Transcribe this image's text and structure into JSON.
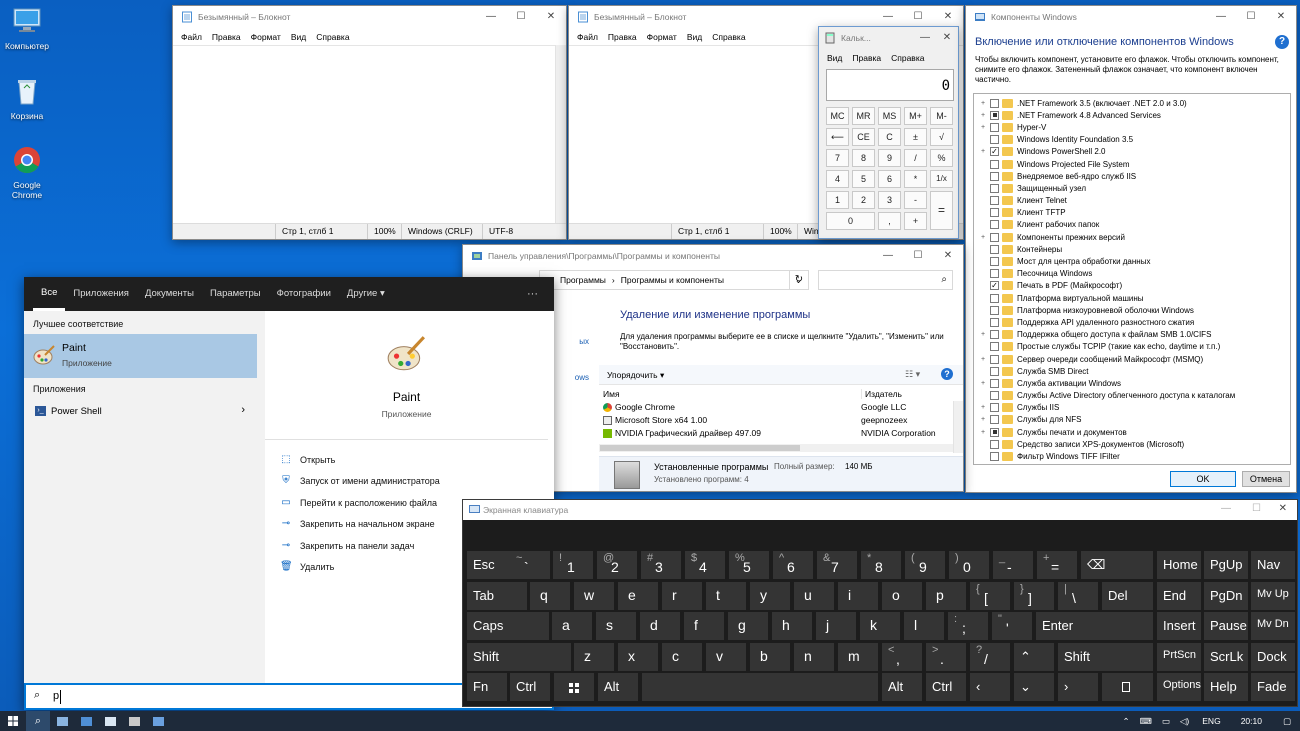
{
  "colors": {
    "accent": "#0078d7",
    "desktop": "#0b6fd8",
    "keyboard_bg": "#1c1c1c",
    "key": "#343434",
    "start_dark": "#1f1f1f"
  },
  "desktop": {
    "icons": [
      {
        "label": "Компьютер",
        "icon": "computer-icon"
      },
      {
        "label": "Корзина",
        "icon": "recycle-bin-icon"
      },
      {
        "label": "Google Chrome",
        "icon": "chrome-icon"
      }
    ]
  },
  "notepad1": {
    "title": "Безымянный – Блокнот",
    "menu": [
      "Файл",
      "Правка",
      "Формат",
      "Вид",
      "Справка"
    ],
    "status": {
      "position": "Стр 1, стлб 1",
      "zoom": "100%",
      "eol": "Windows (CRLF)",
      "encoding": "UTF-8"
    }
  },
  "notepad2": {
    "title": "Безымянный – Блокнот",
    "menu": [
      "Файл",
      "Правка",
      "Формат",
      "Вид",
      "Справка"
    ],
    "status": {
      "position": "Стр 1, стлб 1",
      "zoom": "100%",
      "eol": "Win"
    }
  },
  "calculator": {
    "title": "Кальк...",
    "menu": [
      "Вид",
      "Правка",
      "Справка"
    ],
    "display": "0",
    "buttons": {
      "mc": "MC",
      "mr": "MR",
      "ms": "MS",
      "mplus": "M+",
      "mminus": "M-",
      "back": "⟵",
      "ce": "CE",
      "c": "C",
      "pm": "±",
      "sqrt": "√",
      "n7": "7",
      "n8": "8",
      "n9": "9",
      "div": "/",
      "pct": "%",
      "n4": "4",
      "n5": "5",
      "n6": "6",
      "mul": "*",
      "inv": "1/x",
      "n1": "1",
      "n2": "2",
      "n3": "3",
      "sub": "-",
      "eq": "=",
      "n0": "0",
      "dot": ",",
      "add": "+"
    }
  },
  "components": {
    "title": "Компоненты Windows",
    "heading": "Включение или отключение компонентов Windows",
    "description": "Чтобы включить компонент, установите его флажок. Чтобы отключить компонент, снимите его флажок. Затененный флажок означает, что компонент включен частично.",
    "items": [
      {
        "label": ".NET Framework 3.5 (включает .NET 2.0 и 3.0)",
        "expand": "+",
        "state": ""
      },
      {
        "label": ".NET Framework 4.8 Advanced Services",
        "expand": "+",
        "state": "part"
      },
      {
        "label": "Hyper-V",
        "expand": "+",
        "state": ""
      },
      {
        "label": "Windows Identity Foundation 3.5",
        "expand": "",
        "state": ""
      },
      {
        "label": "Windows PowerShell 2.0",
        "expand": "+",
        "state": "check"
      },
      {
        "label": "Windows Projected File System",
        "expand": "",
        "state": ""
      },
      {
        "label": "Внедряемое веб-ядро служб IIS",
        "expand": "",
        "state": ""
      },
      {
        "label": "Защищенный узел",
        "expand": "",
        "state": ""
      },
      {
        "label": "Клиент Telnet",
        "expand": "",
        "state": ""
      },
      {
        "label": "Клиент TFTP",
        "expand": "",
        "state": ""
      },
      {
        "label": "Клиент рабочих папок",
        "expand": "",
        "state": ""
      },
      {
        "label": "Компоненты прежних версий",
        "expand": "+",
        "state": ""
      },
      {
        "label": "Контейнеры",
        "expand": "",
        "state": ""
      },
      {
        "label": "Мост для центра обработки данных",
        "expand": "",
        "state": ""
      },
      {
        "label": "Песочница Windows",
        "expand": "",
        "state": ""
      },
      {
        "label": "Печать в PDF (Майкрософт)",
        "expand": "",
        "state": "check"
      },
      {
        "label": "Платформа виртуальной машины",
        "expand": "",
        "state": ""
      },
      {
        "label": "Платформа низкоуровневой оболочки Windows",
        "expand": "",
        "state": ""
      },
      {
        "label": "Поддержка API удаленного разностного сжатия",
        "expand": "",
        "state": ""
      },
      {
        "label": "Поддержка общего доступа к файлам SMB 1.0/CIFS",
        "expand": "+",
        "state": ""
      },
      {
        "label": "Простые службы TCPIP (такие как echo, daytime и т.п.)",
        "expand": "",
        "state": ""
      },
      {
        "label": "Сервер очереди сообщений Майкрософт (MSMQ)",
        "expand": "+",
        "state": ""
      },
      {
        "label": "Служба SMB Direct",
        "expand": "",
        "state": ""
      },
      {
        "label": "Служба активации Windows",
        "expand": "+",
        "state": ""
      },
      {
        "label": "Службы Active Directory облегченного доступа к каталогам",
        "expand": "",
        "state": ""
      },
      {
        "label": "Службы IIS",
        "expand": "+",
        "state": ""
      },
      {
        "label": "Службы для NFS",
        "expand": "+",
        "state": ""
      },
      {
        "label": "Службы печати и документов",
        "expand": "+",
        "state": "part"
      },
      {
        "label": "Средство записи XPS-документов (Microsoft)",
        "expand": "",
        "state": ""
      },
      {
        "label": "Фильтр Windows TIFF IFilter",
        "expand": "",
        "state": ""
      }
    ],
    "ok": "OK",
    "cancel": "Отмена"
  },
  "control_panel": {
    "title": "Панель управления\\Программы\\Программы и компоненты",
    "breadcrumb": [
      "Программы",
      "Программы и компоненты"
    ],
    "heading": "Удаление или изменение программы",
    "description": "Для удаления программы выберите ее в списке и щелкните \"Удалить\", \"Изменить\" или \"Восстановить\".",
    "organize": "Упорядочить",
    "col_name": "Имя",
    "col_publisher": "Издатель",
    "programs": [
      {
        "name": "Google Chrome",
        "publisher": "Google LLC"
      },
      {
        "name": "Microsoft Store x64 1.00",
        "publisher": "geepnozeex"
      },
      {
        "name": "NVIDIA Графический драйвер 497.09",
        "publisher": "NVIDIA Corporation"
      }
    ],
    "left_links": [
      "ых",
      "ows"
    ],
    "summary_title": "Установленные программы",
    "summary_size_label": "Полный размер:",
    "summary_size": "140 МБ",
    "summary_count": "Установлено программ: 4"
  },
  "start_menu": {
    "tabs": [
      "Все",
      "Приложения",
      "Документы",
      "Параметры",
      "Фотографии",
      "Другие"
    ],
    "more": "···",
    "best_match_header": "Лучшее соответствие",
    "best_match": {
      "name": "Paint",
      "type": "Приложение"
    },
    "apps_header": "Приложения",
    "apps": [
      {
        "name": "Power Shell"
      }
    ],
    "preview": {
      "name": "Paint",
      "type": "Приложение"
    },
    "actions": [
      {
        "label": "Открыть",
        "icon": "open-icon"
      },
      {
        "label": "Запуск от имени администратора",
        "icon": "admin-icon"
      },
      {
        "label": "Перейти к расположению файла",
        "icon": "folder-icon"
      },
      {
        "label": "Закрепить на начальном экране",
        "icon": "pin-icon"
      },
      {
        "label": "Закрепить на панели задач",
        "icon": "pin-taskbar-icon"
      },
      {
        "label": "Удалить",
        "icon": "trash-icon"
      }
    ],
    "search_value": "p"
  },
  "osk": {
    "title": "Экранная клавиатура",
    "keys": {
      "esc": "Esc",
      "tilde_sup": "~",
      "tilde": "`",
      "n1_sup": "!",
      "n1": "1",
      "n2_sup": "@",
      "n2": "2",
      "n3_sup": "#",
      "n3": "3",
      "n4_sup": "$",
      "n4": "4",
      "n5_sup": "%",
      "n5": "5",
      "n6_sup": "^",
      "n6": "6",
      "n7_sup": "&",
      "n7": "7",
      "n8_sup": "*",
      "n8": "8",
      "n9_sup": "(",
      "n9": "9",
      "n0_sup": ")",
      "n0": "0",
      "minus_sup": "_",
      "minus": "-",
      "eq_sup": "+",
      "eq": "=",
      "bksp": "⌫",
      "tab": "Tab",
      "q": "q",
      "w": "w",
      "e": "e",
      "r": "r",
      "t": "t",
      "y": "y",
      "u": "u",
      "i": "i",
      "o": "o",
      "p": "p",
      "lb_sup": "{",
      "lb": "[",
      "rb_sup": "}",
      "rb": "]",
      "bs_sup": "|",
      "bs": "\\",
      "del": "Del",
      "caps": "Caps",
      "a": "a",
      "s": "s",
      "d": "d",
      "f": "f",
      "g": "g",
      "h": "h",
      "j": "j",
      "k": "k",
      "l": "l",
      "semi_sup": ":",
      "semi": ";",
      "quote_sup": "\"",
      "quote": "'",
      "enter": "Enter",
      "shift": "Shift",
      "z": "z",
      "x": "x",
      "c": "c",
      "v": "v",
      "b": "b",
      "n": "n",
      "m": "m",
      "comma_sup": "<",
      "comma": ",",
      "dot_sup": ">",
      "dot": ".",
      "slash_sup": "?",
      "slash": "/",
      "up": "⌃",
      "rshift": "Shift",
      "fn": "Fn",
      "ctrl": "Ctrl",
      "alt": "Alt",
      "ralt": "Alt",
      "rctrl": "Ctrl",
      "left": "‹",
      "down": "⌄",
      "right": "›",
      "home": "Home",
      "pgup": "PgUp",
      "nav": "Nav",
      "end": "End",
      "pgdn": "PgDn",
      "mvup": "Mv Up",
      "insert": "Insert",
      "pause": "Pause",
      "mvdn": "Mv Dn",
      "prtscn": "PrtScn",
      "scrlk": "ScrLk",
      "dock": "Dock",
      "options": "Options",
      "help": "Help",
      "fade": "Fade"
    }
  },
  "taskbar": {
    "lang": "ENG",
    "time": "20:10"
  }
}
